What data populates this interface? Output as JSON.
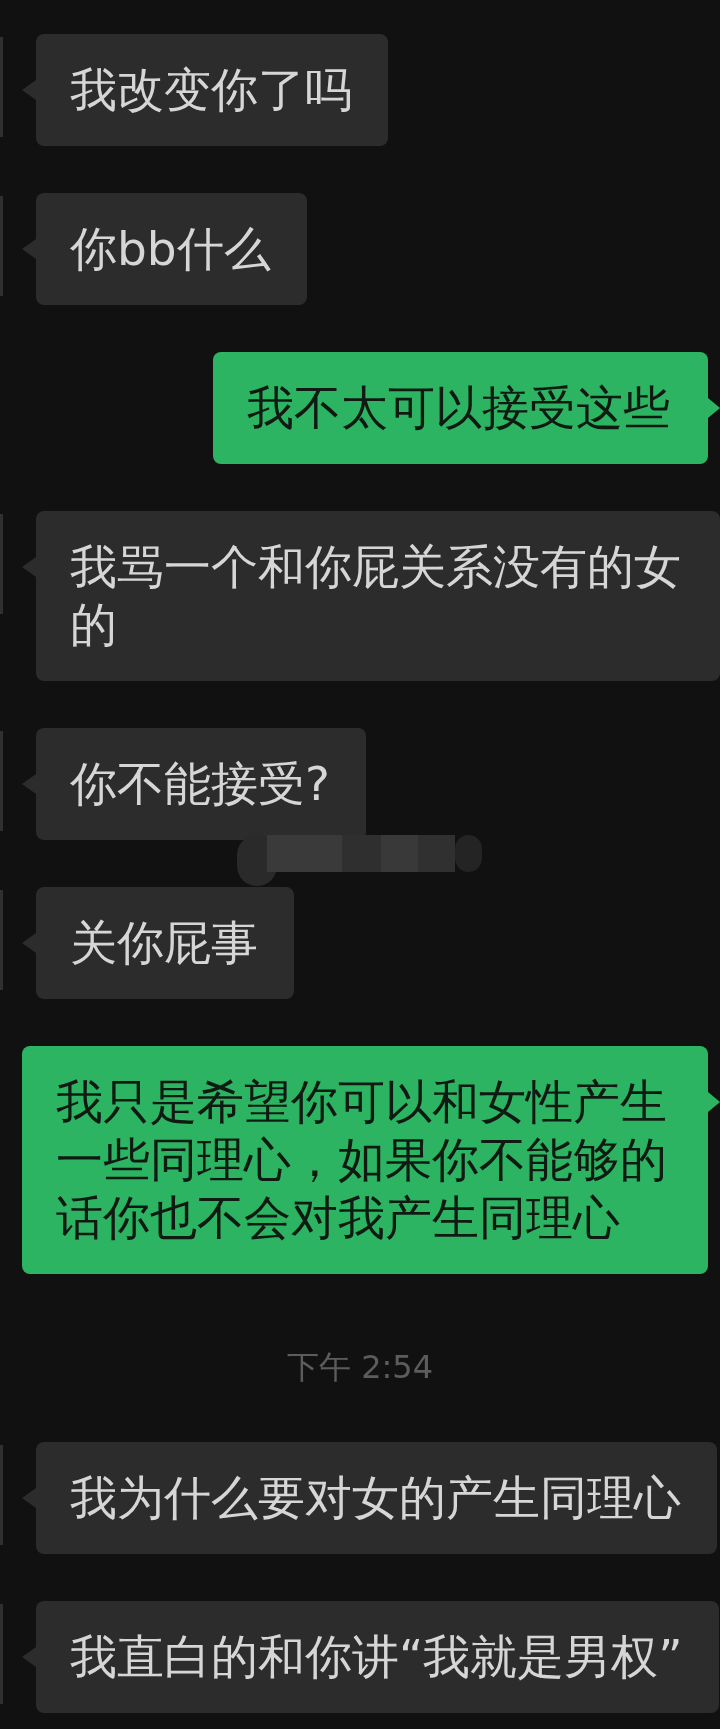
{
  "messages": [
    {
      "kind": "incoming",
      "text": "我改变你了吗"
    },
    {
      "kind": "incoming",
      "text": "你bb什么"
    },
    {
      "kind": "outgoing",
      "text": "我不太可以接受这些"
    },
    {
      "kind": "incoming",
      "text": "我骂一个和你屁关系没有的女的"
    },
    {
      "kind": "incoming",
      "text": "你不能接受?"
    },
    {
      "kind": "redacted"
    },
    {
      "kind": "incoming",
      "text": "关你屁事"
    },
    {
      "kind": "outgoing",
      "text": "我只是希望你可以和女性产生一些同理心，如果你不能够的话你也不会对我产生同理心"
    },
    {
      "kind": "timestamp",
      "text": "下午 2:54"
    },
    {
      "kind": "incoming",
      "text": "我为什么要对女的产生同理心"
    },
    {
      "kind": "incoming",
      "text": "我直白的和你讲“我就是男权”"
    }
  ]
}
